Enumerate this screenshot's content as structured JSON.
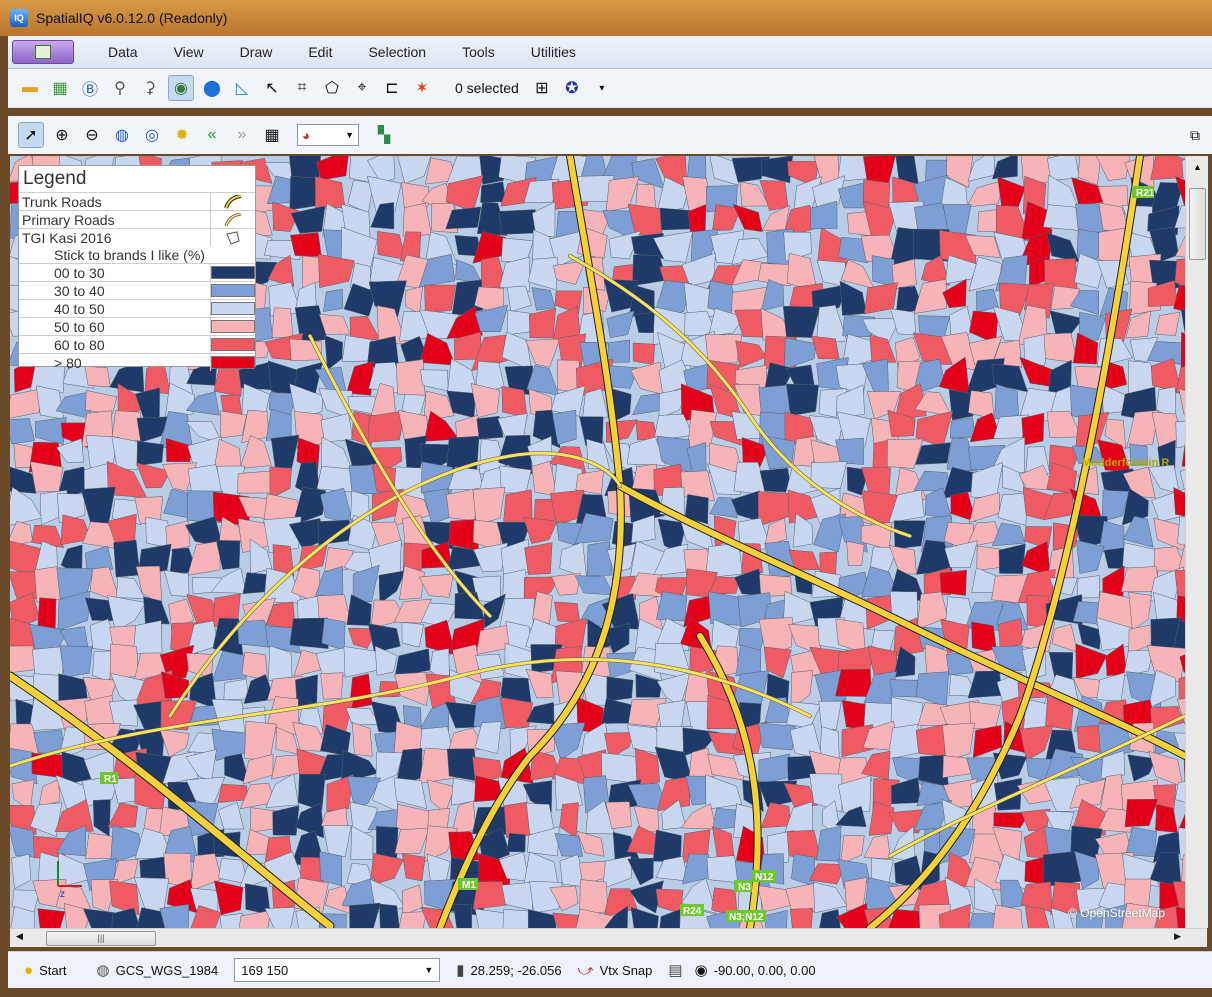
{
  "window": {
    "title": "SpatialIQ v6.0.12.0 (Readonly)",
    "app_icon_text": "IQ"
  },
  "menu": {
    "items": [
      "Data",
      "View",
      "Draw",
      "Edit",
      "Selection",
      "Tools",
      "Utilities"
    ]
  },
  "toolbar": {
    "selected_count": "0 selected"
  },
  "legend": {
    "title": "Legend",
    "rows": [
      {
        "label": "Trunk Roads"
      },
      {
        "label": "Primary Roads"
      },
      {
        "label": "TGI Kasi 2016"
      },
      {
        "label": "Stick to brands I like (%)"
      }
    ],
    "classes": [
      {
        "label": "00 to 30",
        "color": "#1f3a68"
      },
      {
        "label": "30 to 40",
        "color": "#7d9fd6"
      },
      {
        "label": "40 to 50",
        "color": "#c8d7ef"
      },
      {
        "label": "50 to 60",
        "color": "#f6b3b8"
      },
      {
        "label": "60 to 80",
        "color": "#f05a63"
      },
      {
        "label": "> 80",
        "color": "#e5001a"
      }
    ]
  },
  "map_labels": [
    "R21",
    "Modderfontein R",
    "R1",
    "M1",
    "N3",
    "N12",
    "R24",
    "N3;N12"
  ],
  "attribution": "© OpenStreetMap",
  "statusbar": {
    "start": "Start",
    "projection": "GCS_WGS_1984",
    "scale": "169 150",
    "coords": "28.259; -26.056",
    "snap": "Vtx Snap",
    "view": "-90.00, 0.00, 0.00"
  },
  "colors": {
    "dark_blue": "#1f3a68",
    "mid_blue": "#7d9fd6",
    "light_blue": "#c8d7ef",
    "light_red": "#f6b3b8",
    "mid_red": "#f05a63",
    "red": "#e5001a",
    "road": "#f4d03a"
  }
}
